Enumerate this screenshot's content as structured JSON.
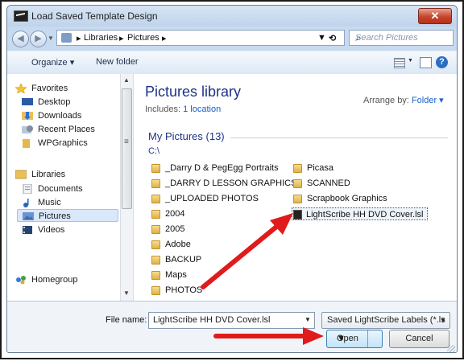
{
  "window": {
    "title": "Load Saved Template Design",
    "close_glyph": "✕"
  },
  "nav": {
    "back_glyph": "◀",
    "forward_glyph": "▶",
    "breadcrumb": [
      "Libraries",
      "Pictures"
    ],
    "separator": "▸",
    "search_placeholder": "Search Pictures",
    "search_icon": "search-icon",
    "refresh_glyph": "⟲"
  },
  "toolbar": {
    "organize": "Organize ▾",
    "new_folder": "New folder",
    "help_glyph": "?"
  },
  "sidebar": {
    "items": [
      {
        "label": "Favorites",
        "icon": "star-icon"
      },
      {
        "label": "Desktop",
        "icon": "desktop-icon"
      },
      {
        "label": "Downloads",
        "icon": "downloads-icon"
      },
      {
        "label": "Recent Places",
        "icon": "recent-places-icon"
      },
      {
        "label": "WPGraphics",
        "icon": "folder-icon"
      },
      {
        "label": "Libraries",
        "icon": "libraries-icon"
      },
      {
        "label": "Documents",
        "icon": "documents-icon"
      },
      {
        "label": "Music",
        "icon": "music-icon"
      },
      {
        "label": "Pictures",
        "icon": "pictures-icon",
        "selected": true
      },
      {
        "label": "Videos",
        "icon": "videos-icon"
      },
      {
        "label": "Homegroup",
        "icon": "homegroup-icon"
      }
    ]
  },
  "library": {
    "title": "Pictures library",
    "includes_prefix": "Includes:",
    "includes_link": "1 location",
    "arrange_label": "Arrange by:",
    "arrange_value": "Folder ▾",
    "group_title": "My Pictures (13)",
    "path": "C:\\"
  },
  "files": {
    "col1": [
      "_Darry D & PegEgg Portraits",
      "_DARRY D LESSON GRAPHICS",
      "_UPLOADED PHOTOS",
      "2004",
      "2005",
      "Adobe",
      "BACKUP",
      "Maps",
      "PHOTOS"
    ],
    "col2": [
      "Picasa",
      "SCANNED",
      "Scrapbook Graphics"
    ],
    "selected_file": "LightScribe HH DVD Cover.lsl"
  },
  "bottom": {
    "filename_label": "File name:",
    "filename_value": "LightScribe HH DVD Cover.lsl",
    "filetype_value": "Saved LightScribe Labels (*.ls",
    "open_label": "Open",
    "cancel_label": "Cancel"
  },
  "annotation": {
    "arrow_color": "#e01b1b"
  }
}
